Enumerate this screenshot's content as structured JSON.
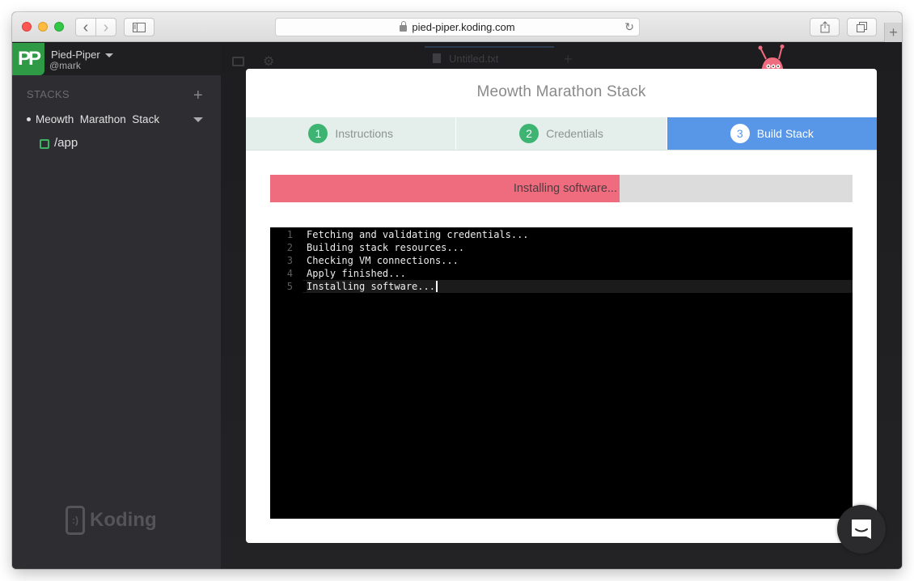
{
  "browser": {
    "url": "pied-piper.koding.com",
    "icons": {
      "back": "chevron-left-icon",
      "forward": "chevron-right-icon",
      "sidebar": "sidebar-icon",
      "lock": "lock-icon",
      "reload": "reload-icon",
      "share": "share-icon",
      "tabs": "tabs-overview-icon",
      "new_tab": "plus-icon"
    },
    "back_glyph": "‹",
    "forward_glyph": "›",
    "reload_glyph": "↻",
    "new_tab_glyph": "+"
  },
  "sidebar": {
    "team": {
      "logo_text": "PP",
      "name": "Pied-Piper",
      "user": "@mark",
      "logo_color": "#2e9a46"
    },
    "stacks_label": "STACKS",
    "add_glyph": "+",
    "stacks": [
      {
        "name": "Meowth  Marathon  Stack",
        "machines": [
          {
            "label": "/app",
            "status_color": "#3db365"
          }
        ]
      }
    ],
    "brand": {
      "mark": ":)",
      "name": "Koding"
    }
  },
  "workspace": {
    "tab_label": "Untitled.txt",
    "gear_glyph": "⚙",
    "plus_glyph": "+"
  },
  "modal": {
    "title": "Meowth Marathon Stack",
    "steps": [
      {
        "number": "1",
        "label": "Instructions",
        "state": "done"
      },
      {
        "number": "2",
        "label": "Credentials",
        "state": "done"
      },
      {
        "number": "3",
        "label": "Build Stack",
        "state": "active"
      }
    ],
    "progress": {
      "label": "Installing software...",
      "percent": 60,
      "fill_color": "#ef6b7e"
    },
    "terminal": {
      "lines": [
        {
          "num": "1",
          "text": "Fetching and validating credentials..."
        },
        {
          "num": "2",
          "text": "Building stack resources..."
        },
        {
          "num": "3",
          "text": "Checking VM connections..."
        },
        {
          "num": "4",
          "text": "Apply finished..."
        },
        {
          "num": "5",
          "text": "Installing software..."
        }
      ]
    }
  },
  "colors": {
    "accent_blue": "#5897e8",
    "step_green": "#3db472",
    "progress_pink": "#ef6b7e"
  }
}
